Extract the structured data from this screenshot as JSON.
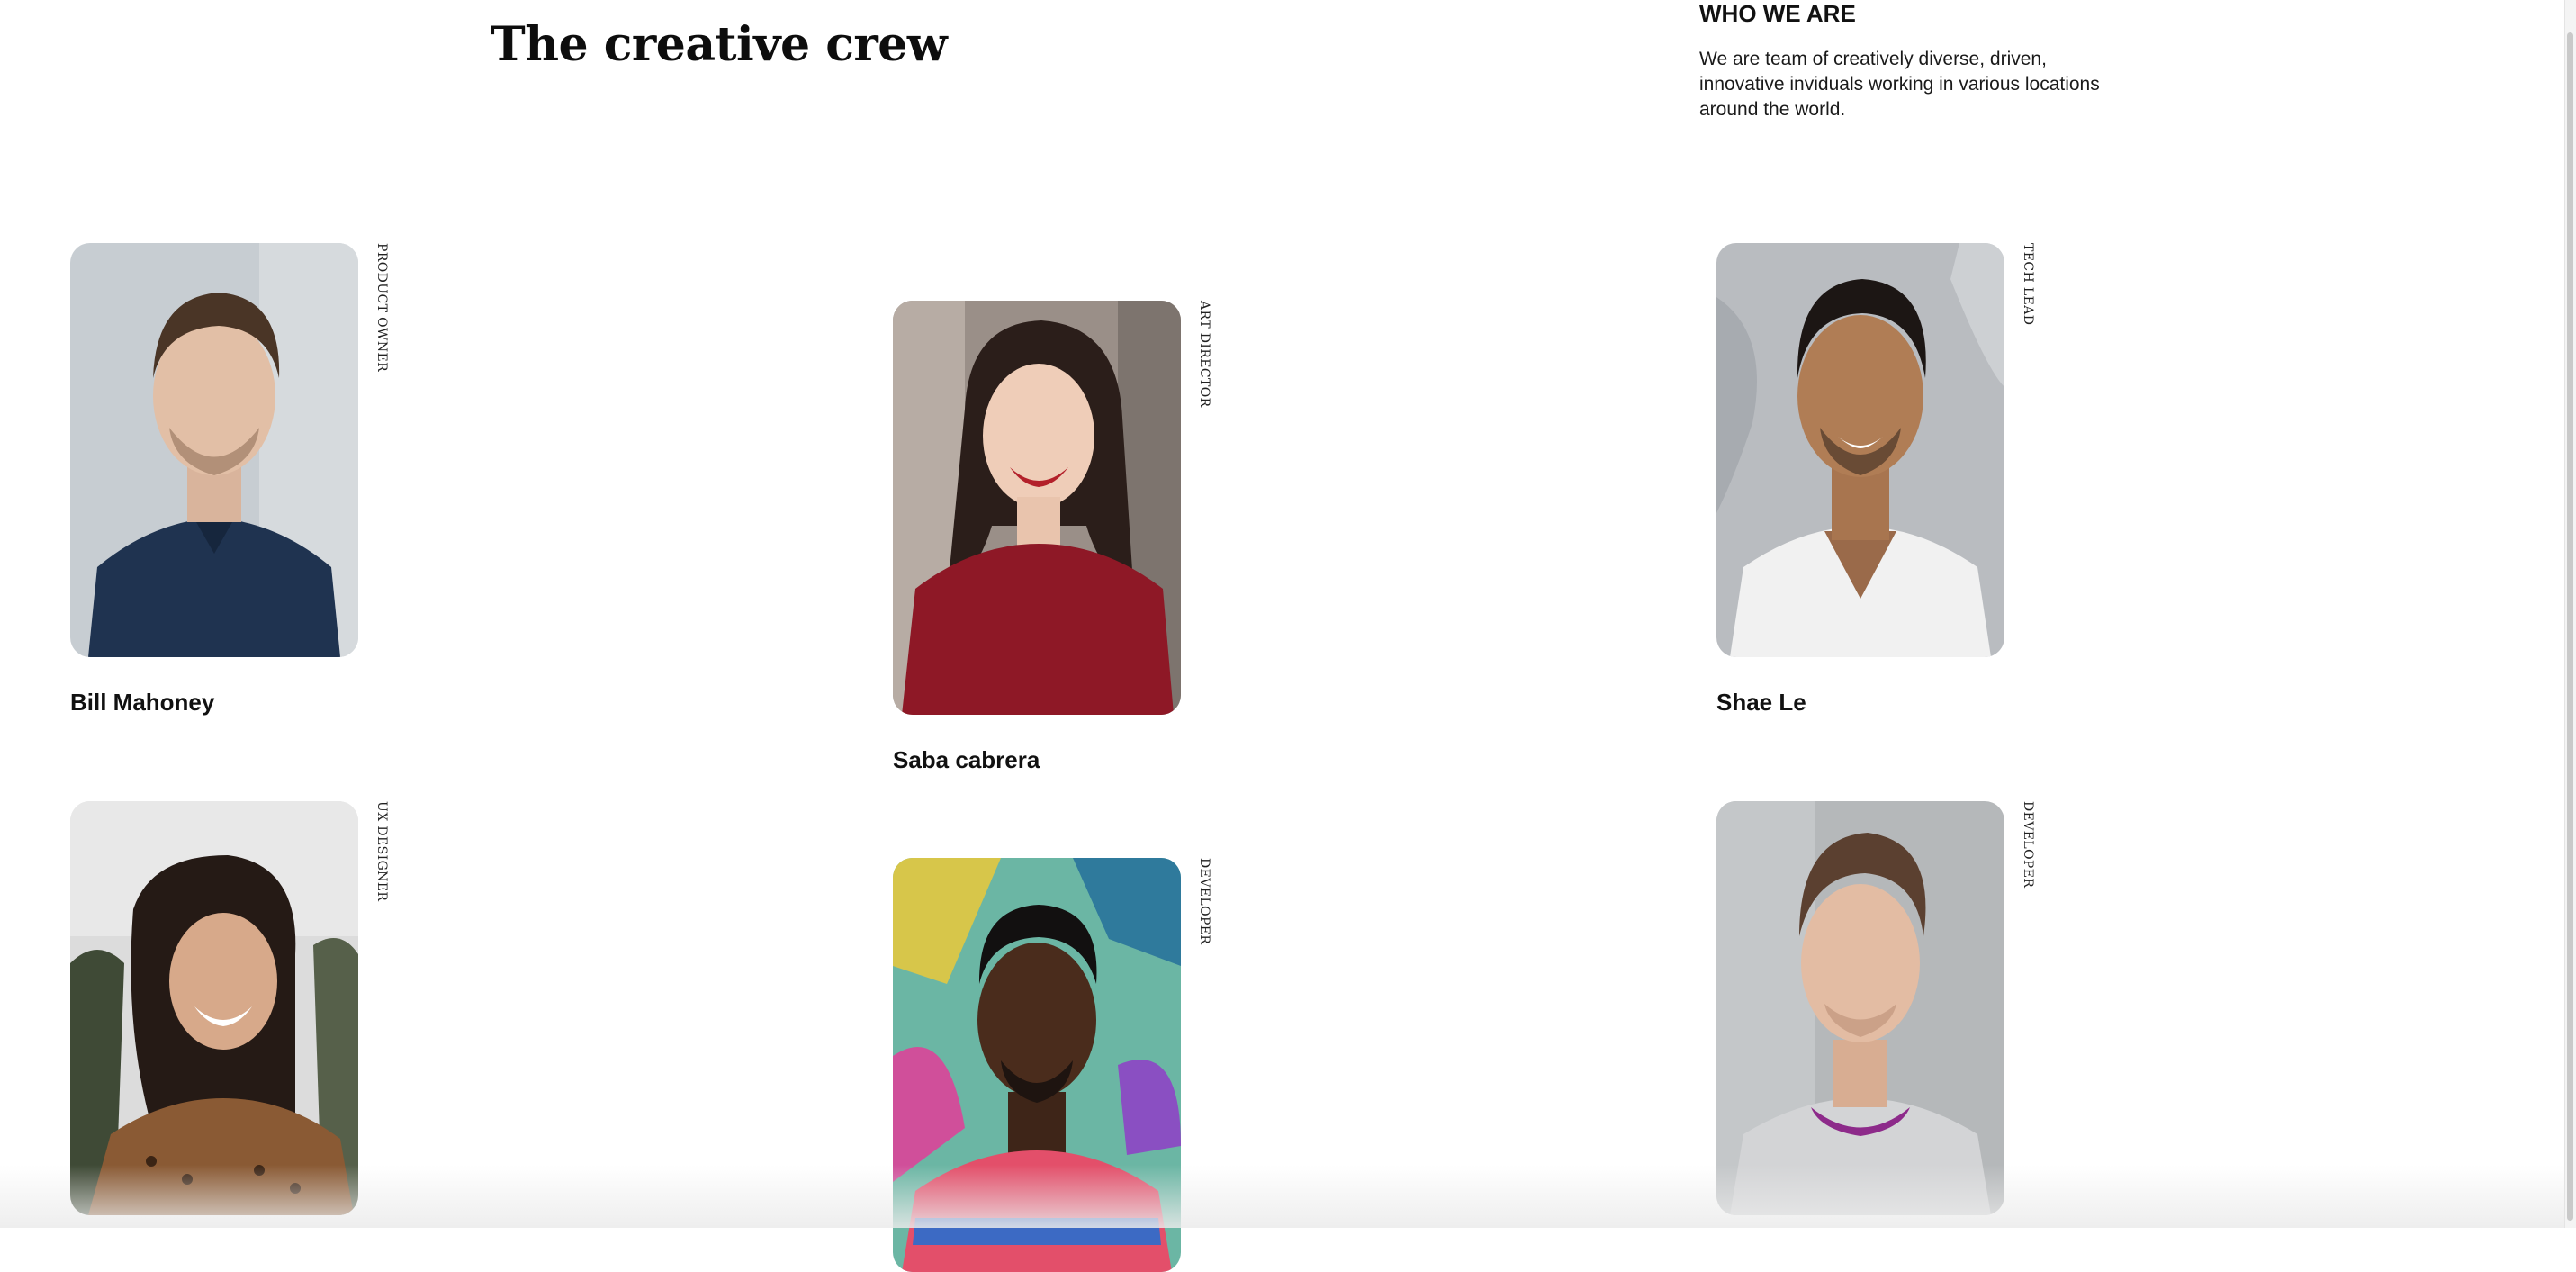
{
  "header": {
    "title": "The creative crew"
  },
  "about": {
    "heading": "WHO WE ARE",
    "text": "We are team of creatively diverse, driven, innovative inviduals working in various locations around the world."
  },
  "members": [
    {
      "name": "Bill Mahoney",
      "role": "PRODUCT OWNER",
      "photo": "man-portrait"
    },
    {
      "name": "Saba cabrera",
      "role": "ART DIRECTOR",
      "photo": "woman-portrait"
    },
    {
      "name": "Shae Le",
      "role": "TECH LEAD",
      "photo": "man-portrait"
    },
    {
      "name": "",
      "role": "UX DESIGNER",
      "photo": "woman-portrait"
    },
    {
      "name": "",
      "role": "DEVELOPER",
      "photo": "man-portrait"
    },
    {
      "name": "",
      "role": "DEVELOPER",
      "photo": "man-portrait"
    }
  ],
  "colors": {
    "text": "#111111",
    "background": "#ffffff"
  }
}
